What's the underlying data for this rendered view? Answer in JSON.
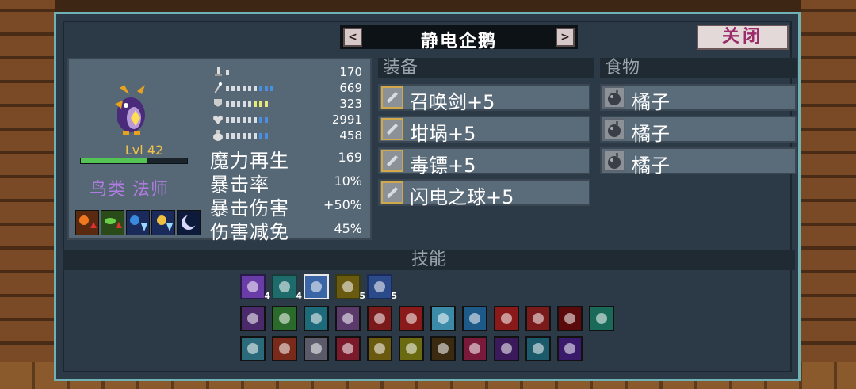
{
  "character": {
    "name": "静电企鹅",
    "level": "Lvl 42",
    "xp_progress": 0.62,
    "class": "鸟类 法师"
  },
  "buttons": {
    "prev": "<",
    "next": ">",
    "close": "关闭"
  },
  "stats": [
    {
      "icon": "sword-icon",
      "value": "170",
      "bars": 1
    },
    {
      "icon": "wand-icon",
      "value": "669",
      "bars": 9
    },
    {
      "icon": "shield-icon",
      "value": "323",
      "bars": 8
    },
    {
      "icon": "heart-icon",
      "value": "2991",
      "bars": 8
    },
    {
      "icon": "potion-icon",
      "value": "458",
      "bars": 8
    }
  ],
  "bonus_stats": [
    {
      "label": "魔力再生",
      "value": "169"
    },
    {
      "label": "暴击率",
      "value": "10%"
    },
    {
      "label": "暴击伤害",
      "value": "+50%"
    },
    {
      "label": "伤害减免",
      "value": "45%"
    }
  ],
  "equipment": {
    "header": "装备",
    "items": [
      {
        "label": "召唤剑+5",
        "icon": "summon-sword-icon"
      },
      {
        "label": "坩埚+5",
        "icon": "cauldron-icon"
      },
      {
        "label": "毒镖+5",
        "icon": "poison-dart-icon"
      },
      {
        "label": "闪电之球+5",
        "icon": "lightning-orb-icon"
      }
    ]
  },
  "food": {
    "header": "食物",
    "items": [
      {
        "label": "橘子",
        "icon": "orange-icon"
      },
      {
        "label": "橘子",
        "icon": "orange-icon"
      },
      {
        "label": "橘子",
        "icon": "orange-icon"
      }
    ]
  },
  "skills": {
    "header": "技能",
    "active": [
      {
        "icon": "echo-skill-icon",
        "level": "4",
        "color": "#6a3ca8"
      },
      {
        "icon": "spin-skill-icon",
        "level": "4",
        "color": "#1d6b6b"
      },
      {
        "icon": "storm-skill-icon",
        "level": "",
        "color": "#3a66a8"
      },
      {
        "icon": "bolt-skill-icon",
        "level": "5",
        "color": "#6a5a10"
      },
      {
        "icon": "spark-skill-icon",
        "level": "5",
        "color": "#2a4a8a"
      }
    ],
    "passive_row1": [
      {
        "icon": "staff-skill-icon",
        "color": "#4a2a6a"
      },
      {
        "icon": "figure-skill-icon",
        "color": "#2a6a2a"
      },
      {
        "icon": "head-skill-icon",
        "color": "#1d6b7a"
      },
      {
        "icon": "cloud-skill-icon",
        "color": "#5a3a6a"
      },
      {
        "icon": "gem-skill-icon",
        "color": "#7a1a1a"
      },
      {
        "icon": "plus-skill-icon",
        "color": "#8a1a1a"
      },
      {
        "icon": "tooth-skill-icon",
        "color": "#3a8aa8"
      },
      {
        "icon": "fang-skill-icon",
        "color": "#1d5a8a"
      },
      {
        "icon": "rage-skill-icon",
        "color": "#8a1a1a"
      },
      {
        "icon": "claw-skill-icon",
        "color": "#7a1a1a"
      },
      {
        "icon": "cross-skill-icon",
        "color": "#5a0a0a"
      },
      {
        "icon": "ring-skill-icon",
        "color": "#1a6a5a"
      }
    ],
    "passive_row2": [
      {
        "icon": "drip-skill-icon",
        "color": "#2a6a7a"
      },
      {
        "icon": "blocks-skill-icon",
        "color": "#7a2a1a"
      },
      {
        "icon": "vortex-skill-icon",
        "color": "#5a5a6a"
      },
      {
        "icon": "burst-skill-icon",
        "color": "#7a1a2a"
      },
      {
        "icon": "swirl-skill-icon",
        "color": "#6a5a10"
      },
      {
        "icon": "gear-skill-icon",
        "color": "#6a6a10"
      },
      {
        "icon": "flame-skill-icon",
        "color": "#3a2a10"
      },
      {
        "icon": "dots-skill-icon",
        "color": "#7a1a3a"
      },
      {
        "icon": "orbs-skill-icon",
        "color": "#3a1a5a"
      },
      {
        "icon": "stick-skill-icon",
        "color": "#1a5a6a"
      },
      {
        "icon": "potion-skill-icon",
        "color": "#3a1a6a"
      }
    ]
  }
}
